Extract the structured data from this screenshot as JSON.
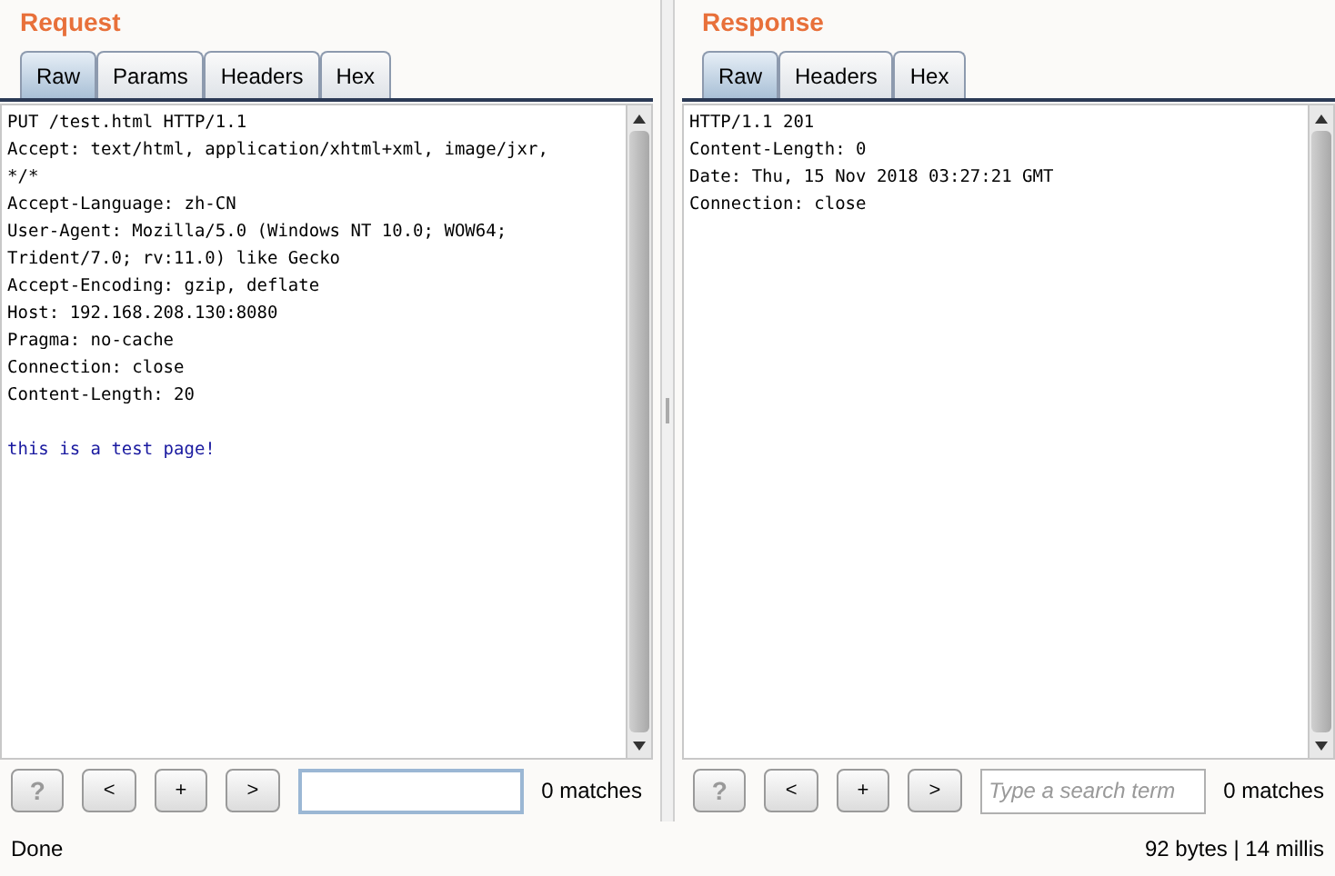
{
  "panels": [
    {
      "title": "Request",
      "tabs": [
        {
          "label": "Raw",
          "selected": true
        },
        {
          "label": "Params",
          "selected": false
        },
        {
          "label": "Headers",
          "selected": false
        },
        {
          "label": "Hex",
          "selected": false
        }
      ],
      "header_lines": [
        "PUT /test.html HTTP/1.1",
        "Accept: text/html, application/xhtml+xml, image/jxr,",
        "*/*",
        "Accept-Language: zh-CN",
        "User-Agent: Mozilla/5.0 (Windows NT 10.0; WOW64;",
        "Trident/7.0; rv:11.0) like Gecko",
        "Accept-Encoding: gzip, deflate",
        "Host: 192.168.208.130:8080",
        "Pragma: no-cache",
        "Connection: close",
        "Content-Length: 20"
      ],
      "body": "this is a test page!",
      "search": {
        "buttons": [
          "?",
          "<",
          "+",
          ">"
        ],
        "focused": true,
        "matches": "0 matches"
      },
      "status": "Done"
    },
    {
      "title": "Response",
      "tabs": [
        {
          "label": "Raw",
          "selected": true
        },
        {
          "label": "Headers",
          "selected": false
        },
        {
          "label": "Hex",
          "selected": false
        }
      ],
      "header_lines": [
        "HTTP/1.1 201",
        "Content-Length: 0",
        "Date: Thu, 15 Nov 2018 03:27:21 GMT",
        "Connection: close"
      ],
      "search": {
        "buttons": [
          "?",
          "<",
          "+",
          ">"
        ],
        "focused": false,
        "placeholder": "Type a search term",
        "matches": "0 matches"
      },
      "status": "92 bytes | 14 millis"
    }
  ]
}
